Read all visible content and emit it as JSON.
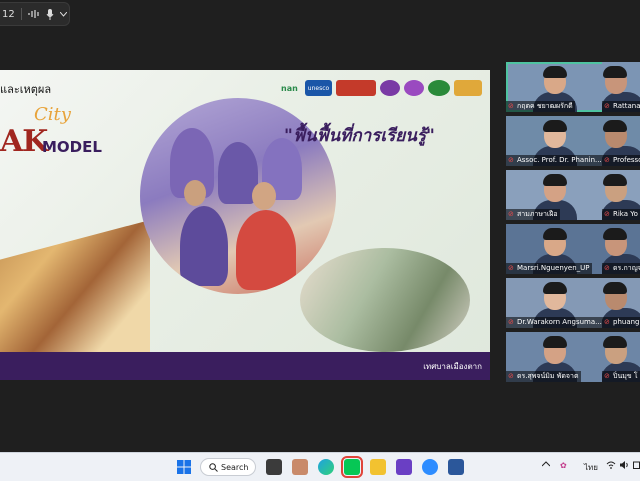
{
  "meeting_bar": {
    "participant_count": "12",
    "sound_icon": "sound-wave-icon",
    "mic_icon": "microphone-icon",
    "chevron_icon": "chevron-down-icon"
  },
  "slide": {
    "heading_top": "และเหตุผล",
    "heading_city": "City",
    "heading_ak": "AK",
    "heading_model": "MODEL",
    "slogan": "\"ฟื้นฟื้นที่การเรียนรู้\"",
    "logos": [
      "nan",
      "unesco",
      "",
      "",
      "",
      ""
    ],
    "caption": "เทศบาลเมืองตาก",
    "accent_color": "#3a1e5e"
  },
  "participants": [
    {
      "name": "กฤตค ชยาฒผรักดี",
      "active": true
    },
    {
      "name": "Rattana"
    },
    {
      "name": "Assoc. Prof. Dr. Phanin..."
    },
    {
      "name": "Professo"
    },
    {
      "name": "สามภาษาเฝือ"
    },
    {
      "name": "Rika Yo"
    },
    {
      "name": "Marsri.Nguenyen_UP"
    },
    {
      "name": "ดร.กาญจ"
    },
    {
      "name": "Dr.Warakorn Angsuma..."
    },
    {
      "name": "phuang"
    },
    {
      "name": "ดร.สุพจน์มิม พัดจาต"
    },
    {
      "name": "ปิ่นมุข โ"
    }
  ],
  "taskbar": {
    "search_label": "Search",
    "tray_language": "ไทย",
    "tray_chevron": "chevron-up-icon"
  }
}
